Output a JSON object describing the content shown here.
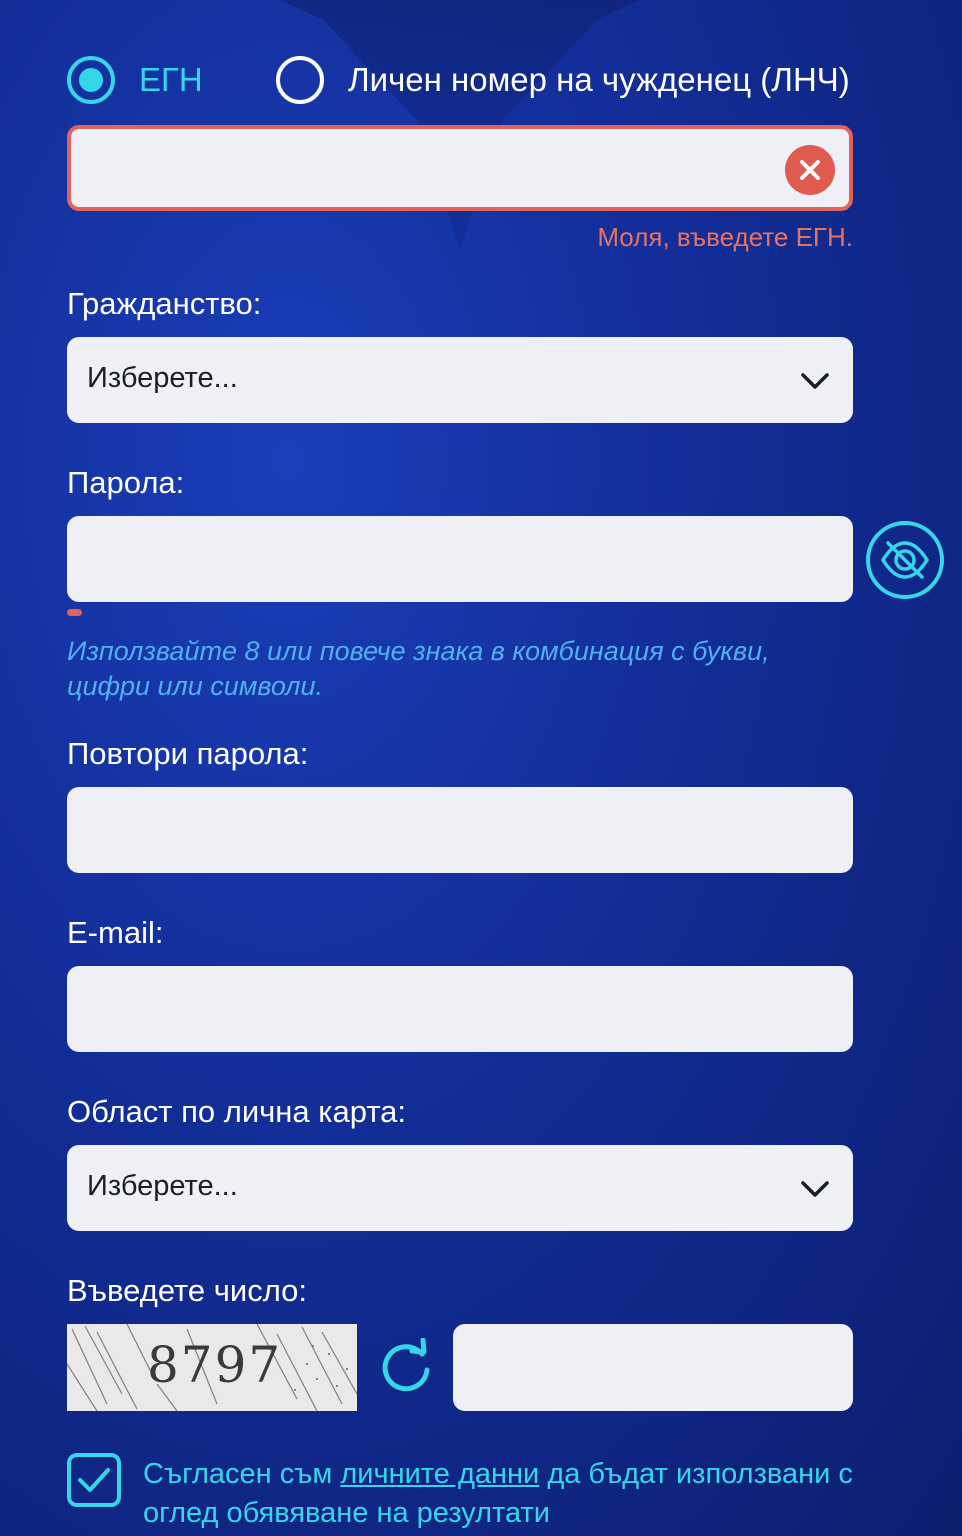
{
  "id_type": {
    "option_egn": "ЕГН",
    "option_lnch": "Личен номер на чужденец (ЛНЧ)",
    "selected": "egn"
  },
  "id_field": {
    "value": "",
    "error": "Моля, въведете ЕГН."
  },
  "citizenship": {
    "label": "Гражданство:",
    "selected": "Изберете..."
  },
  "password": {
    "label": "Парола:",
    "value": "",
    "hint": "Използвайте 8 или повече знака в комбинация с букви, цифри или символи."
  },
  "repeat_password": {
    "label": "Повтори парола:",
    "value": ""
  },
  "email": {
    "label": "E-mail:",
    "value": ""
  },
  "region": {
    "label": "Област по лична карта:",
    "selected": "Изберете..."
  },
  "captcha": {
    "label": "Въведете число:",
    "image_text": "8797",
    "value": ""
  },
  "consent": {
    "text_before": "Съгласен съм ",
    "link_text": "личните данни",
    "text_after": " да бъдат използвани с оглед обявяване на резултати",
    "checked": true
  },
  "colors": {
    "accent": "#34d6e8",
    "error": "#e0645c",
    "hint": "#4fb1f0",
    "field_bg": "#eef0f6"
  },
  "icons": {
    "clear": "close-icon",
    "dropdown": "chevron-down-icon",
    "password_toggle": "eye-slash-icon",
    "captcha_refresh": "refresh-icon",
    "checkbox": "checkmark-icon"
  }
}
